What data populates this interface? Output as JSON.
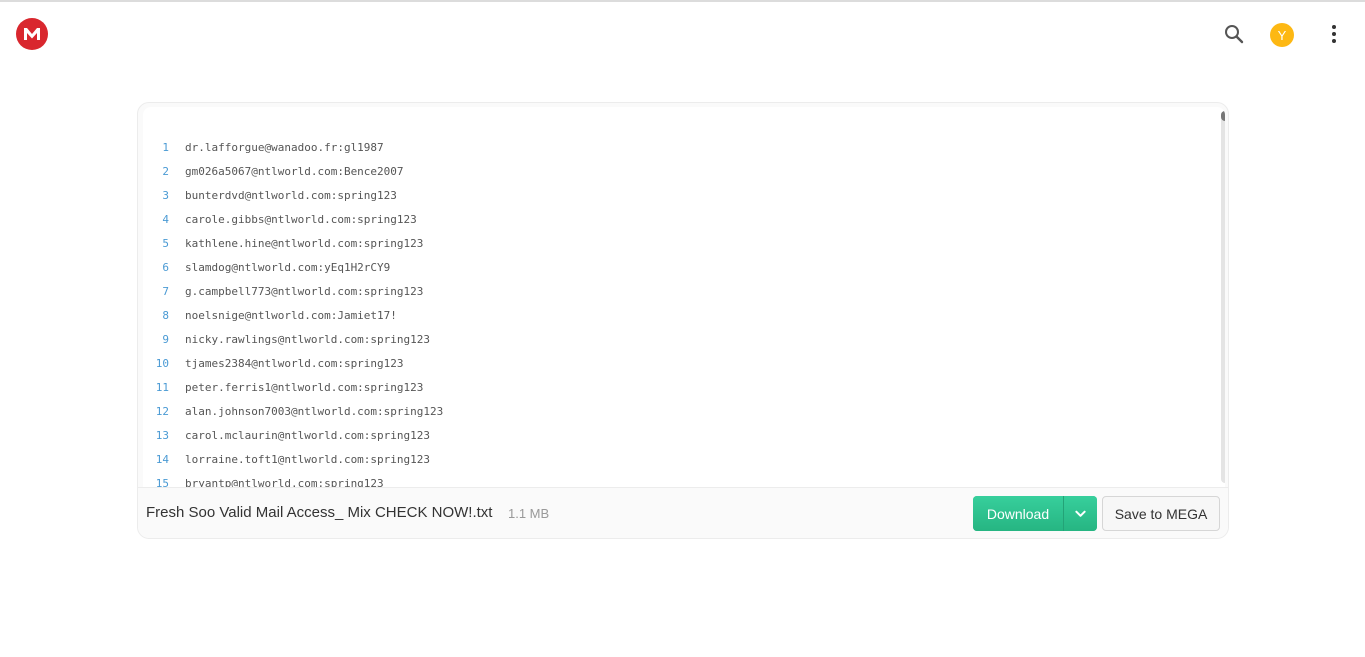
{
  "header": {
    "logo_icon": "mega-logo-icon",
    "search_icon": "search-icon",
    "avatar_initial": "Y",
    "avatar_color": "#fdb813",
    "menu_icon": "more-vertical-icon",
    "brand_color": "#d9272e"
  },
  "editor": {
    "lines": [
      {
        "num": "1",
        "text": "dr.lafforgue@wanadoo.fr:gl1987"
      },
      {
        "num": "2",
        "text": "gm026a5067@ntlworld.com:Bence2007"
      },
      {
        "num": "3",
        "text": "bunterdvd@ntlworld.com:spring123"
      },
      {
        "num": "4",
        "text": "carole.gibbs@ntlworld.com:spring123"
      },
      {
        "num": "5",
        "text": "kathlene.hine@ntlworld.com:spring123"
      },
      {
        "num": "6",
        "text": "slamdog@ntlworld.com:yEq1H2rCY9"
      },
      {
        "num": "7",
        "text": "g.campbell773@ntlworld.com:spring123"
      },
      {
        "num": "8",
        "text": "noelsnige@ntlworld.com:Jamiet17!"
      },
      {
        "num": "9",
        "text": "nicky.rawlings@ntlworld.com:spring123"
      },
      {
        "num": "10",
        "text": "tjames2384@ntlworld.com:spring123"
      },
      {
        "num": "11",
        "text": "peter.ferris1@ntlworld.com:spring123"
      },
      {
        "num": "12",
        "text": "alan.johnson7003@ntlworld.com:spring123"
      },
      {
        "num": "13",
        "text": "carol.mclaurin@ntlworld.com:spring123"
      },
      {
        "num": "14",
        "text": "lorraine.toft1@ntlworld.com:spring123"
      },
      {
        "num": "15",
        "text": "bryantp@ntlworld.com:spring123"
      }
    ]
  },
  "file": {
    "name": "Fresh Soo Valid Mail Access_ Mix CHECK NOW!.txt",
    "size": "1.1 MB"
  },
  "actions": {
    "download_label": "Download",
    "download_color": "#2bbd8b",
    "dropdown_icon": "chevron-down-icon",
    "save_label": "Save to MEGA"
  }
}
